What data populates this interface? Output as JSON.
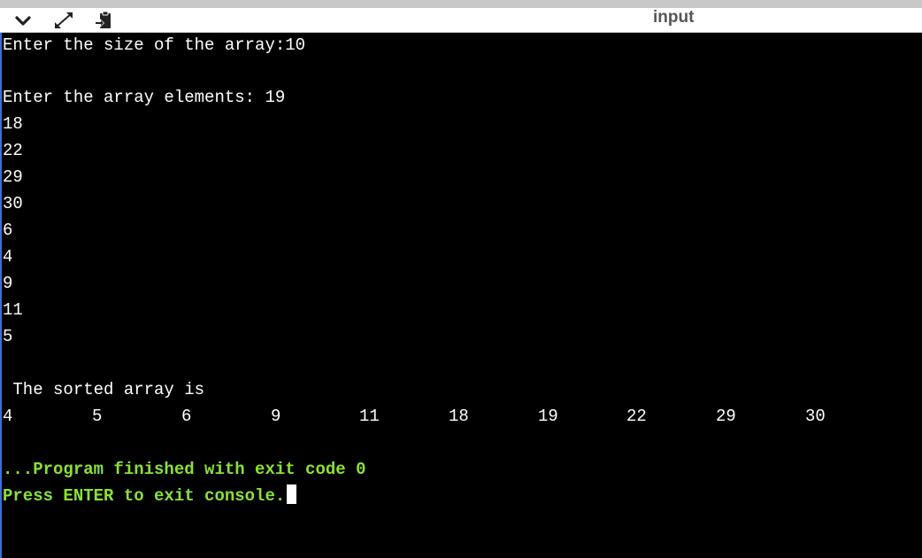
{
  "panel": {
    "title": "input",
    "icons": [
      "chevron-down-icon",
      "expand-icon",
      "copy-icon"
    ]
  },
  "console": {
    "size_prompt": "Enter the size of the array:10",
    "elements_prompt": "Enter the array elements: 19",
    "inputs": [
      "18",
      "22",
      "29",
      "30",
      "6",
      "4",
      "9",
      "11",
      "5"
    ],
    "sorted_label": " The sorted array is",
    "sorted_values": [
      "4",
      "5",
      "6",
      "9",
      "11",
      "18",
      "19",
      "22",
      "29",
      "30"
    ],
    "exit_message": "...Program finished with exit code 0",
    "press_enter": "Press ENTER to exit console."
  },
  "colors": {
    "background": "#000000",
    "text": "#ffffff",
    "status": "#8ae234",
    "toolbar": "#ffffff"
  }
}
